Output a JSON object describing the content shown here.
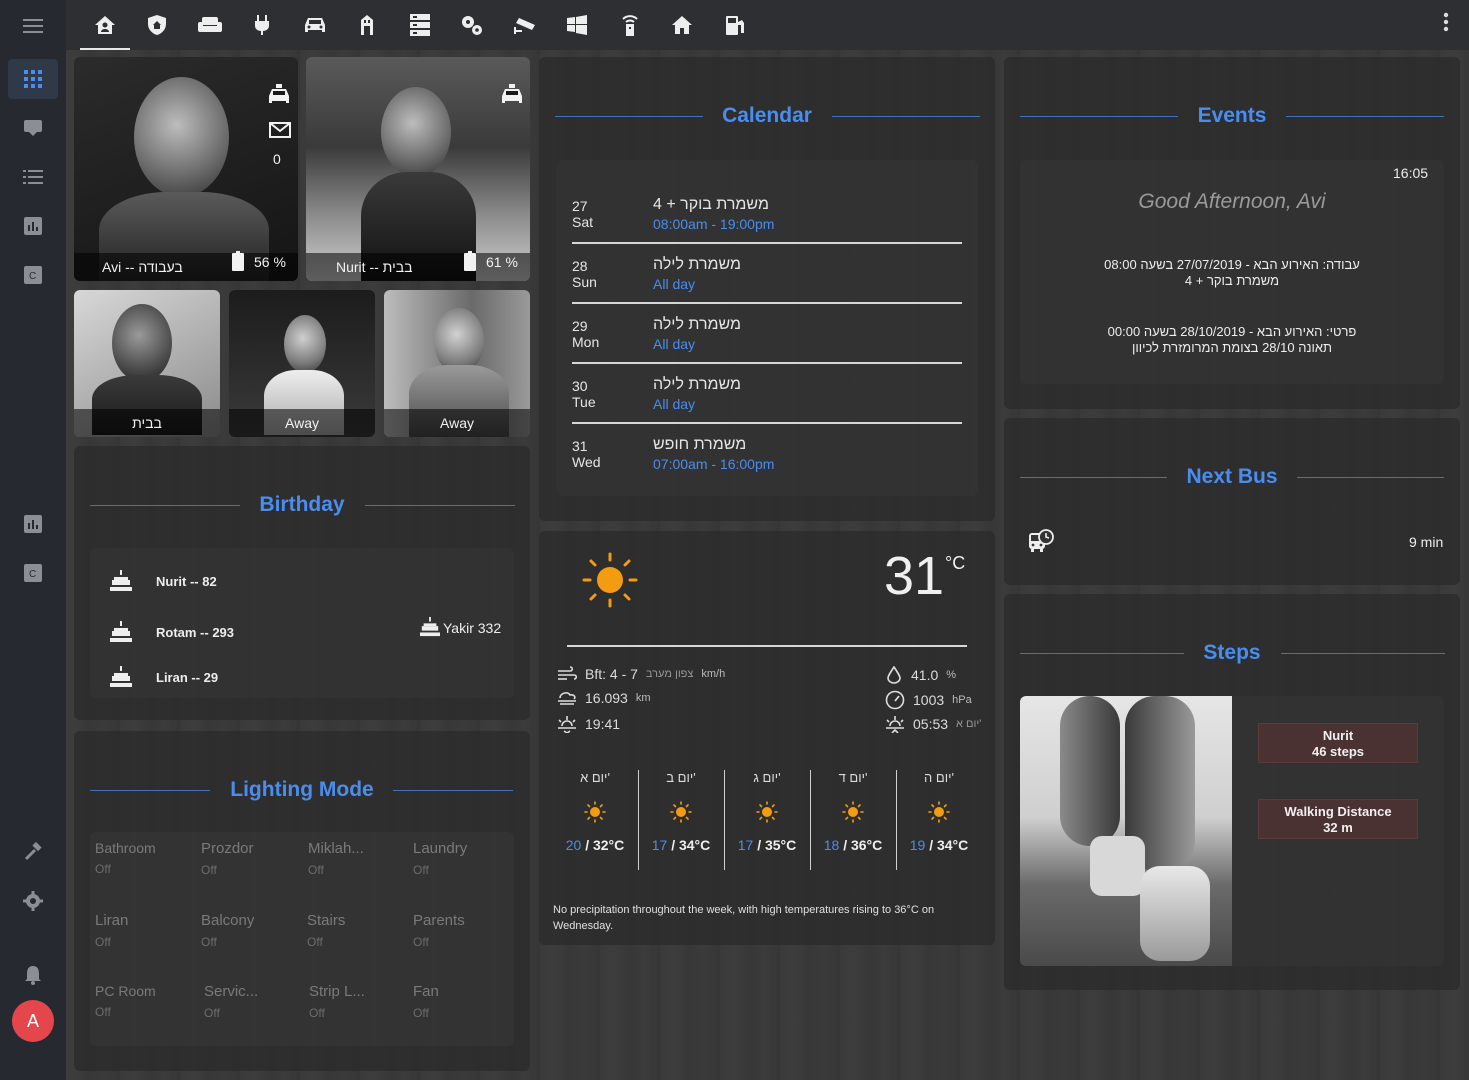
{
  "sidebar": {
    "items": [
      "apps-icon",
      "inbox-icon",
      "list-icon",
      "chart-icon",
      "card-icon",
      "chart-icon",
      "card-icon"
    ],
    "avatar_letter": "A"
  },
  "topbar": {
    "tabs": [
      "home-account-icon",
      "shield-home-icon",
      "sofa-icon",
      "power-plug-icon",
      "car-icon",
      "door-icon",
      "server-icon",
      "cogs-icon",
      "cctv-icon",
      "windows-icon",
      "router-icon",
      "home-icon",
      "fuel-icon"
    ]
  },
  "people": {
    "avi": {
      "caption": "Avi -- בעבודה",
      "battery": "56 %",
      "mail_count": "0"
    },
    "nurit": {
      "caption": "Nurit -- בבית",
      "battery": "61 %"
    },
    "p3": {
      "caption": "בבית"
    },
    "p4": {
      "caption": "Away"
    },
    "p5": {
      "caption": "Away"
    }
  },
  "birthday": {
    "title": "Birthday",
    "items": [
      {
        "label": "Nurit -- 82"
      },
      {
        "label": "Rotam -- 293"
      },
      {
        "label": "Liran -- 29"
      }
    ],
    "next": "Yakir 332"
  },
  "lighting": {
    "title": "Lighting Mode",
    "items": [
      {
        "name": "Bathroom",
        "state": "Off"
      },
      {
        "name": "Prozdor",
        "state": "Off"
      },
      {
        "name": "Miklah...",
        "state": "Off"
      },
      {
        "name": "Laundry",
        "state": "Off"
      },
      {
        "name": "Liran",
        "state": "Off"
      },
      {
        "name": "Balcony",
        "state": "Off"
      },
      {
        "name": "Stairs",
        "state": "Off"
      },
      {
        "name": "Parents",
        "state": "Off"
      },
      {
        "name": "PC Room",
        "state": "Off"
      },
      {
        "name": "Servic...",
        "state": "Off"
      },
      {
        "name": "Strip L...",
        "state": "Off"
      },
      {
        "name": "Fan",
        "state": "Off"
      }
    ]
  },
  "calendar": {
    "title": "Calendar",
    "events": [
      {
        "day": "27",
        "dow": "Sat",
        "title": "משמרת בוקר + 4",
        "time": "08:00am - 19:00pm"
      },
      {
        "day": "28",
        "dow": "Sun",
        "title": "משמרת לילה",
        "time": "All day"
      },
      {
        "day": "29",
        "dow": "Mon",
        "title": "משמרת לילה",
        "time": "All day"
      },
      {
        "day": "30",
        "dow": "Tue",
        "title": "משמרת לילה",
        "time": "All day"
      },
      {
        "day": "31",
        "dow": "Wed",
        "title": "משמרת חופש",
        "time": "07:00am - 16:00pm"
      }
    ]
  },
  "weather": {
    "temp": "31",
    "unit": "°C",
    "wind": "Bft: 4 - 7",
    "wind_dir": "צפון מערב",
    "wind_unit": "km/h",
    "visibility": "16.093",
    "visibility_unit": "km",
    "sunset": "19:41",
    "humidity": "41.0",
    "humidity_unit": "%",
    "pressure": "1003",
    "pressure_unit": "hPa",
    "sunrise": "05:53",
    "sunrise_day": "יום א'",
    "forecast": [
      {
        "day": "יום א'",
        "low": "20",
        "high": "32°C"
      },
      {
        "day": "יום ב'",
        "low": "17",
        "high": "34°C"
      },
      {
        "day": "יום ג'",
        "low": "17",
        "high": "35°C"
      },
      {
        "day": "יום ד'",
        "low": "18",
        "high": "36°C"
      },
      {
        "day": "יום ה'",
        "low": "19",
        "high": "34°C"
      }
    ],
    "summary": "No precipitation throughout the week, with high temperatures rising to 36°C on Wednesday."
  },
  "events": {
    "title": "Events",
    "time": "16:05",
    "greeting": "Good Afternoon, Avi",
    "line1a": "עבודה: האירוע הבא - 27/07/2019 בשעה 08:00",
    "line1b": "משמרת בוקר + 4",
    "line2a": "פרטי: האירוע הבא - 28/10/2019 בשעה 00:00",
    "line2b": "תאונה 28/10 בצומת המרומזרת לכיוון"
  },
  "bus": {
    "title": "Next Bus",
    "value": "9 min"
  },
  "steps": {
    "title": "Steps",
    "badge1_name": "Nurit",
    "badge1_value": "46 steps",
    "badge2_name": "Walking Distance",
    "badge2_value": "32 m"
  }
}
